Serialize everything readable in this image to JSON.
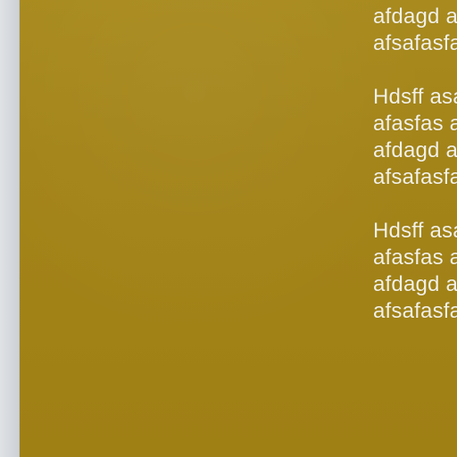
{
  "colors": {
    "panel_background": "#A3841A",
    "text": "#F3F1E6",
    "left_edge": "#D7DADD"
  },
  "main": {
    "paragraphs": [
      {
        "lines": [
          "afdagd a",
          "afsafasfa"
        ]
      },
      {
        "lines": [
          "Hdsff asa",
          "afasfas a",
          "afdagd a",
          "afsafasfa"
        ]
      },
      {
        "lines": [
          "Hdsff asa",
          "afasfas a",
          "afdagd a",
          "afsafasfa"
        ]
      }
    ]
  }
}
